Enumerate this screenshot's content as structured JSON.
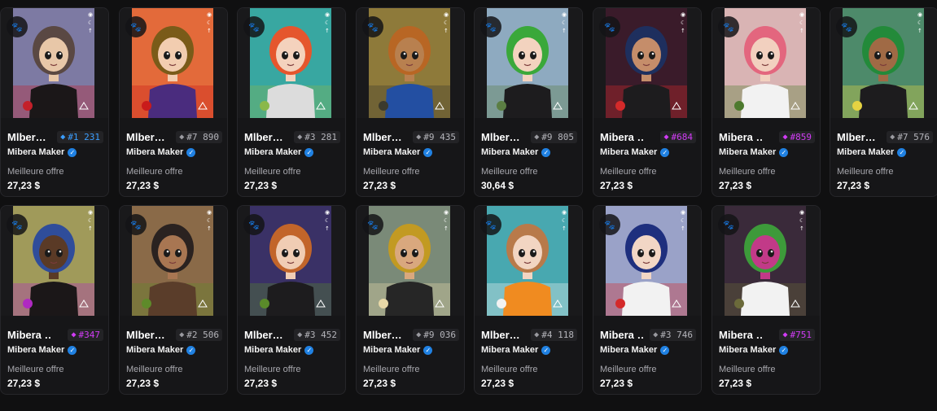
{
  "collection": "Mibera Maker",
  "best_offer_label": "Meilleure offre",
  "collection_badge_icon": "paw-icon",
  "cards": [
    {
      "name": "Mlber…",
      "token": "#1 231",
      "rarity_color": "#3b9eff",
      "price": "27,23 $",
      "bg": "#7d7aa3",
      "skin": "#e8c7a8",
      "hair": "#5a4843",
      "shirt": "#1b1718",
      "accent": "#c4202a"
    },
    {
      "name": "Mlber…",
      "token": "#7 890",
      "rarity_color": "#9a9aa0",
      "price": "27,23 $",
      "bg": "#e36a3a",
      "skin": "#f2cdb0",
      "hair": "#7a5b19",
      "shirt": "#4a2c7e",
      "accent": "#c91b1b"
    },
    {
      "name": "Mlber…",
      "token": "#3 281",
      "rarity_color": "#9a9aa0",
      "price": "27,23 $",
      "bg": "#38a7a1",
      "skin": "#f4d2bd",
      "hair": "#e5562d",
      "shirt": "#dcdcdc",
      "accent": "#8ab84a"
    },
    {
      "name": "Mlber…",
      "token": "#9 435",
      "rarity_color": "#9a9aa0",
      "price": "27,23 $",
      "bg": "#8e7a3a",
      "skin": "#b8804f",
      "hair": "#b86624",
      "shirt": "#234fa2",
      "accent": "#3b3a2d"
    },
    {
      "name": "Mlber…",
      "token": "#9 805",
      "rarity_color": "#9a9aa0",
      "price": "30,64 $",
      "bg": "#8eaac0",
      "skin": "#f3d3bf",
      "hair": "#3aa83a",
      "shirt": "#1d1c1e",
      "accent": "#5b7e43"
    },
    {
      "name": "Mibera …",
      "token": "#684",
      "rarity_color": "#d13cf5",
      "price": "27,23 $",
      "bg": "#3a1b2a",
      "skin": "#c58d6a",
      "hair": "#1e2f5e",
      "shirt": "#1d1c1e",
      "accent": "#d42a2a"
    },
    {
      "name": "Mibera …",
      "token": "#859",
      "rarity_color": "#d13cf5",
      "price": "27,23 $",
      "bg": "#d9b4b4",
      "skin": "#f2d0bf",
      "hair": "#e3667e",
      "shirt": "#f2f2f2",
      "accent": "#4d7a2e"
    },
    {
      "name": "Mlber…",
      "token": "#7 576",
      "rarity_color": "#9a9aa0",
      "price": "27,23 $",
      "bg": "#4d8a6a",
      "skin": "#a06a45",
      "hair": "#238a3a",
      "shirt": "#1d1c1e",
      "accent": "#e5d342"
    },
    {
      "name": "Mibera …",
      "token": "#347",
      "rarity_color": "#d13cf5",
      "price": "27,23 $",
      "bg": "#a09a5a",
      "skin": "#5a3a26",
      "hair": "#2f4d9a",
      "shirt": "#1b1718",
      "accent": "#b02ac2"
    },
    {
      "name": "Mlber…",
      "token": "#2 506",
      "rarity_color": "#9a9aa0",
      "price": "27,23 $",
      "bg": "#8a6a48",
      "skin": "#a87652",
      "hair": "#2a2220",
      "shirt": "#5a3d2a",
      "accent": "#5e8a2a"
    },
    {
      "name": "Mlber…",
      "token": "#3 452",
      "rarity_color": "#9a9aa0",
      "price": "27,23 $",
      "bg": "#3a3166",
      "skin": "#f0cdb4",
      "hair": "#c2652a",
      "shirt": "#1d1c1e",
      "accent": "#5a8a2a"
    },
    {
      "name": "Mlber…",
      "token": "#9 036",
      "rarity_color": "#9a9aa0",
      "price": "27,23 $",
      "bg": "#7a8a78",
      "skin": "#d9a87e",
      "hair": "#c29a22",
      "shirt": "#262626",
      "accent": "#e8d8a8"
    },
    {
      "name": "Mlber…",
      "token": "#4 118",
      "rarity_color": "#9a9aa0",
      "price": "27,23 $",
      "bg": "#48a8b0",
      "skin": "#f2d5c2",
      "hair": "#b87a4a",
      "shirt": "#f08b20",
      "accent": "#f2f2f2"
    },
    {
      "name": "Mibera …",
      "token": "#3 746",
      "rarity_color": "#9a9aa0",
      "price": "27,23 $",
      "bg": "#9aa2c8",
      "skin": "#f2d6c5",
      "hair": "#1e2f7e",
      "shirt": "#f2f2f2",
      "accent": "#d42a2a"
    },
    {
      "name": "Mibera …",
      "token": "#751",
      "rarity_color": "#d13cf5",
      "price": "27,23 $",
      "bg": "#3a2a3a",
      "skin": "#c23a88",
      "hair": "#3d9a3a",
      "shirt": "#f2f2f2",
      "accent": "#6b6a3a"
    }
  ]
}
